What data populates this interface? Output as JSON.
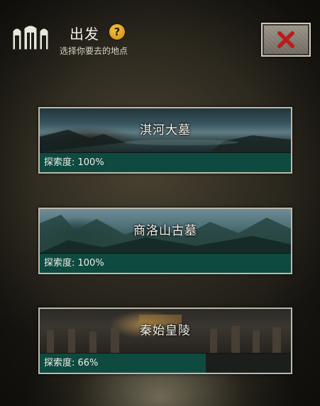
{
  "header": {
    "title": "出发",
    "subtitle": "选择你要去的地点",
    "help_glyph": "?",
    "icons": {
      "header": "tomb-door-icon",
      "help": "question-icon",
      "close": "close-icon"
    }
  },
  "colors": {
    "progress_fill": "#0e4a40",
    "progress_track": "#1a1f1c",
    "help_badge": "#f0b428",
    "close_x": "#b81c1c"
  },
  "locations": [
    {
      "name": "淇河大墓",
      "progress_label": "探索度: 100%",
      "progress": 100
    },
    {
      "name": "商洛山古墓",
      "progress_label": "探索度: 100%",
      "progress": 100
    },
    {
      "name": "秦始皇陵",
      "progress_label": "探索度: 66%",
      "progress": 66
    }
  ]
}
